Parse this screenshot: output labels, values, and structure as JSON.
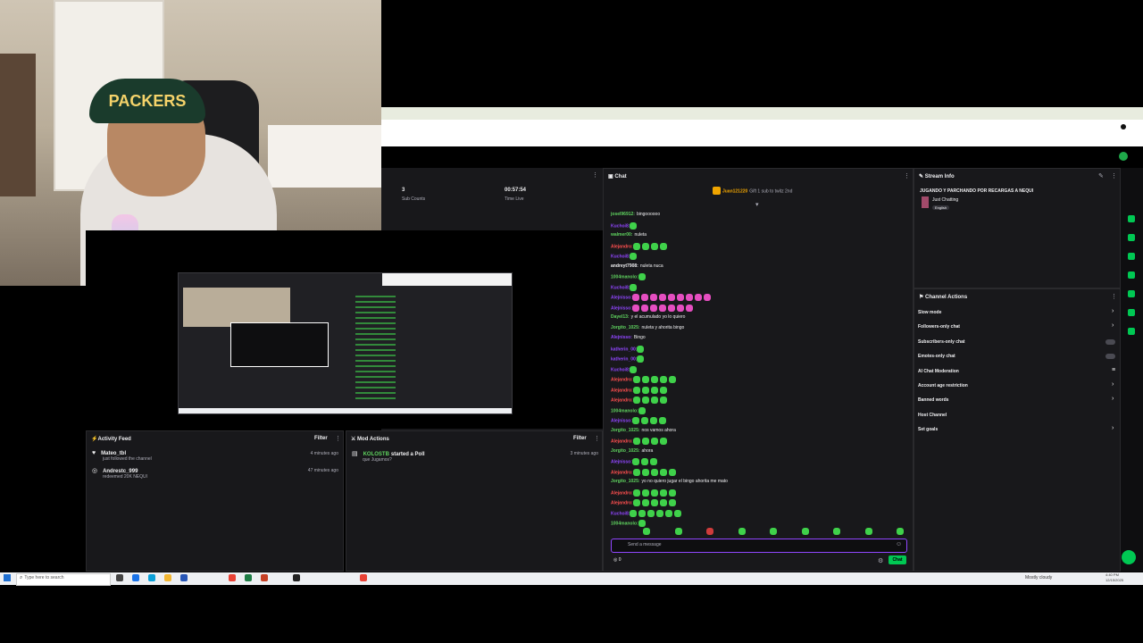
{
  "webcam": {
    "cap_text": "PACKERS"
  },
  "stats": [
    {
      "value": "3",
      "label": "Sub Counts"
    },
    {
      "value": "00:57:54",
      "label": "Time Live"
    }
  ],
  "chat": {
    "header": "Chat",
    "pinned_user": "Juan121220",
    "pinned_text": "Gift 1 sub to twitz 2nd",
    "placeholder": "Send a message",
    "send_label": "Chat",
    "points": "0",
    "messages": [
      {
        "user": "josel96912:",
        "text": "bingoooooo",
        "color": "#5fd35f",
        "emotes": 0
      },
      {
        "user": "Kuchoi8:",
        "text": "",
        "color": "#9146ff",
        "emotes": 1
      },
      {
        "user": "walmer00:",
        "text": "nuleta",
        "color": "#5fd35f",
        "emotes": 0
      },
      {
        "user": "Alejandro:",
        "text": "",
        "color": "#ff4f4f",
        "emotes": 4
      },
      {
        "user": "Kuchoi8:",
        "text": "",
        "color": "#9146ff",
        "emotes": 1
      },
      {
        "user": "andreyt7908:",
        "text": "nuleta nuca",
        "color": "#efeff1",
        "emotes": 0
      },
      {
        "user": "1004manolo:",
        "text": "",
        "color": "#5fd35f",
        "emotes": 1
      },
      {
        "user": "Kuchoi8:",
        "text": "",
        "color": "#9146ff",
        "emotes": 1
      },
      {
        "user": "Alejnisso:",
        "text": "",
        "color": "#9146ff",
        "emotes": 9,
        "pink": true
      },
      {
        "user": "Alejnisso:",
        "text": "",
        "color": "#9146ff",
        "emotes": 7,
        "pink": true
      },
      {
        "user": "Dayel13:",
        "text": "y el acumulado yo lo quiero",
        "color": "#5fd35f",
        "emotes": 0
      },
      {
        "user": "Jorgito_1025:",
        "text": "nuleta y ahorita bingo",
        "color": "#5fd35f",
        "emotes": 0
      },
      {
        "user": "Alejnisso:",
        "text": "Bingo",
        "color": "#9146ff",
        "emotes": 0
      },
      {
        "user": "katherin_00:",
        "text": "",
        "color": "#9146ff",
        "emotes": 1
      },
      {
        "user": "katherin_00:",
        "text": "",
        "color": "#9146ff",
        "emotes": 1
      },
      {
        "user": "Kuchoi8:",
        "text": "",
        "color": "#9146ff",
        "emotes": 1
      },
      {
        "user": "Alejandro:",
        "text": "",
        "color": "#ff4f4f",
        "emotes": 5
      },
      {
        "user": "Alejandro:",
        "text": "",
        "color": "#ff4f4f",
        "emotes": 4
      },
      {
        "user": "Alejandro:",
        "text": "",
        "color": "#ff4f4f",
        "emotes": 4
      },
      {
        "user": "1004manolo:",
        "text": "",
        "color": "#5fd35f",
        "emotes": 1
      },
      {
        "user": "Alejnisso:",
        "text": "",
        "color": "#9146ff",
        "emotes": 4
      },
      {
        "user": "Jorgito_1025:",
        "text": "nos vamos ahora",
        "color": "#5fd35f",
        "emotes": 0
      },
      {
        "user": "Alejandro:",
        "text": "",
        "color": "#ff4f4f",
        "emotes": 4
      },
      {
        "user": "Jorgito_1025:",
        "text": "ahora",
        "color": "#5fd35f",
        "emotes": 0
      },
      {
        "user": "Alejnisso:",
        "text": "",
        "color": "#9146ff",
        "emotes": 3
      },
      {
        "user": "Alejandro:",
        "text": "",
        "color": "#ff4f4f",
        "emotes": 5
      },
      {
        "user": "Jorgito_1025:",
        "text": "yo no quiero jugar el bingo ahorita me mato",
        "color": "#5fd35f",
        "emotes": 0
      },
      {
        "user": "Alejandro:",
        "text": "",
        "color": "#ff4f4f",
        "emotes": 5
      },
      {
        "user": "Alejandro:",
        "text": "",
        "color": "#ff4f4f",
        "emotes": 5
      },
      {
        "user": "Kuchoi8:",
        "text": "",
        "color": "#9146ff",
        "emotes": 6
      },
      {
        "user": "1004manolo:",
        "text": "",
        "color": "#5fd35f",
        "emotes": 1
      }
    ]
  },
  "stream_info": {
    "header": "Stream Info",
    "title": "JUGANDO Y PARCHANDO POR RECARGAS A NEQUI",
    "category": "Just Chatting",
    "tag": "English"
  },
  "channel_actions": {
    "header": "Channel Actions",
    "items": [
      {
        "label": "Slow mode",
        "control": "chevron"
      },
      {
        "label": "Followers-only chat",
        "control": "chevron"
      },
      {
        "label": "Subscribers-only chat",
        "control": "toggle"
      },
      {
        "label": "Emotes-only chat",
        "control": "toggle"
      },
      {
        "label": "AI Chat Moderation",
        "control": "icon"
      },
      {
        "label": "Account age restriction",
        "control": "chevron"
      },
      {
        "label": "Banned words",
        "control": "chevron"
      },
      {
        "label": "Host Channel",
        "control": "none"
      },
      {
        "label": "Set goals",
        "control": "chevron"
      }
    ]
  },
  "activity_feed": {
    "header": "Activity Feed",
    "filter": "Filter",
    "items": [
      {
        "user": "Mateo_tbl",
        "action": "just followed the channel",
        "time": "4 minutes ago"
      },
      {
        "user": "Andrestc_999",
        "action": "redeemed 20K NEQUI",
        "time": "47 minutes ago"
      }
    ]
  },
  "mod_actions": {
    "header": "Mod Actions",
    "filter": "Filter",
    "items": [
      {
        "user": "KOLOSTB",
        "action": "started a Poll",
        "sub": "que Jugamos?",
        "time": "3 minutes ago"
      }
    ]
  },
  "taskbar": {
    "search_placeholder": "Type here to search",
    "weather": "Mostly cloudy",
    "time": "4:40 PM",
    "date": "12/15/2025"
  },
  "colors": {
    "accent": "#00c853",
    "panel_bg": "#18181b",
    "purple": "#9146ff"
  }
}
